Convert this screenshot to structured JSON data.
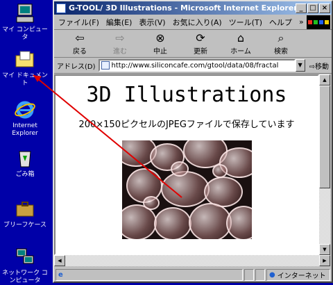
{
  "desktop": {
    "icons": [
      {
        "label": "マイ コンピュータ"
      },
      {
        "label": "マイ ドキュメント"
      },
      {
        "label": "Internet Explorer"
      },
      {
        "label": "ごみ箱"
      },
      {
        "label": "ブリーフケース"
      },
      {
        "label": "ネットワーク コンピュータ"
      }
    ]
  },
  "window": {
    "title": "G-TOOL/ 3D Illustrations - Microsoft Internet Explorer",
    "controls": {
      "minimize": "_",
      "maximize": "□",
      "close": "×"
    },
    "menu": [
      "ファイル(F)",
      "編集(E)",
      "表示(V)",
      "お気に入り(A)",
      "ツール(T)",
      "ヘルプ",
      "»"
    ],
    "toolbar": [
      {
        "label": "戻る",
        "icon": "back-arrow-icon",
        "glyph": "⇦",
        "enabled": true
      },
      {
        "label": "進む",
        "icon": "forward-arrow-icon",
        "glyph": "⇨",
        "enabled": false
      },
      {
        "label": "中止",
        "icon": "stop-icon",
        "glyph": "⊗",
        "enabled": true
      },
      {
        "label": "更新",
        "icon": "refresh-icon",
        "glyph": "⟳",
        "enabled": true
      },
      {
        "label": "ホーム",
        "icon": "home-icon",
        "glyph": "⌂",
        "enabled": true
      },
      {
        "label": "検索",
        "icon": "search-icon",
        "glyph": "⌕",
        "enabled": true
      }
    ],
    "address": {
      "label": "アドレス(D)",
      "url": "http://www.siliconcafe.com/gtool/data/08/fractal",
      "go": "移動"
    },
    "page": {
      "title": "3D Illustrations",
      "description": "200×150ピクセルのJPEGファイルで保存しています"
    },
    "status": {
      "zone": "インターネット"
    }
  },
  "colors": {
    "desktop": "#0000a8",
    "title_start": "#08246b",
    "title_end": "#a5c8f0",
    "arrow": "#e00000"
  }
}
